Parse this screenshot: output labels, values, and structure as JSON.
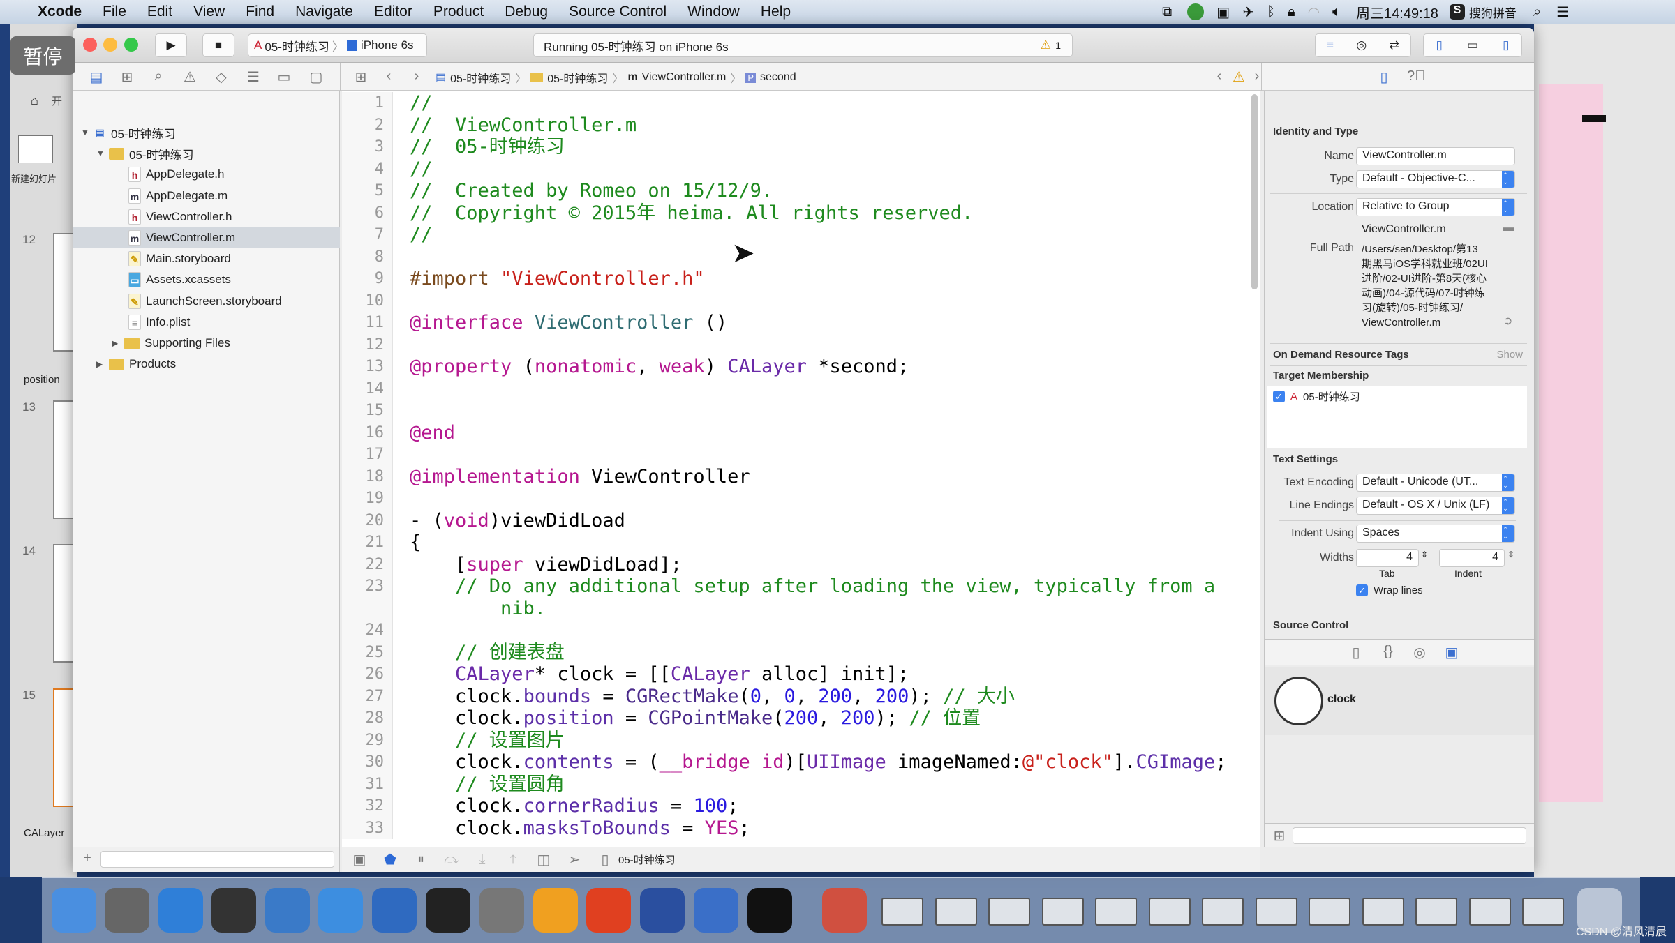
{
  "menubar": {
    "app": "Xcode",
    "items": [
      "File",
      "Edit",
      "View",
      "Find",
      "Navigate",
      "Editor",
      "Product",
      "Debug",
      "Source Control",
      "Window",
      "Help"
    ],
    "clock": "周三14:49:18",
    "input_method": "搜狗拼音"
  },
  "overlay": {
    "pause": "暂停"
  },
  "background_app": {
    "toolbar_label": "开",
    "new_slide": "新建幻灯片",
    "slide_numbers": [
      "12",
      "13",
      "14",
      "15"
    ],
    "section_position": "position",
    "section_calayer": "CALayer"
  },
  "toolbar": {
    "scheme": "05-时钟练习",
    "device": "iPhone 6s",
    "activity": "Running 05-时钟练习 on iPhone 6s",
    "warning_count": "1"
  },
  "jumpbar": {
    "crumbs": [
      "05-时钟练习",
      "05-时钟练习",
      "ViewController.m",
      "second"
    ]
  },
  "navigator": {
    "items": [
      {
        "label": "05-时钟练习",
        "kind": "project",
        "depth": 0,
        "expanded": true
      },
      {
        "label": "05-时钟练习",
        "kind": "folder",
        "depth": 1,
        "expanded": true
      },
      {
        "label": "AppDelegate.h",
        "kind": "h",
        "depth": 2
      },
      {
        "label": "AppDelegate.m",
        "kind": "m",
        "depth": 2
      },
      {
        "label": "ViewController.h",
        "kind": "h",
        "depth": 2
      },
      {
        "label": "ViewController.m",
        "kind": "m",
        "depth": 2,
        "selected": true
      },
      {
        "label": "Main.storyboard",
        "kind": "storyboard",
        "depth": 2
      },
      {
        "label": "Assets.xcassets",
        "kind": "assets",
        "depth": 2
      },
      {
        "label": "LaunchScreen.storyboard",
        "kind": "storyboard",
        "depth": 2
      },
      {
        "label": "Info.plist",
        "kind": "plist",
        "depth": 2
      },
      {
        "label": "Supporting Files",
        "kind": "folder",
        "depth": 2,
        "expanded": false
      },
      {
        "label": "Products",
        "kind": "folder",
        "depth": 1,
        "expanded": false
      }
    ]
  },
  "editor": {
    "lines": [
      {
        "n": "1",
        "t": [
          [
            "//",
            "c"
          ]
        ]
      },
      {
        "n": "2",
        "t": [
          [
            "//  ViewController.m",
            "c"
          ]
        ]
      },
      {
        "n": "3",
        "t": [
          [
            "//  05-时钟练习",
            "c"
          ]
        ]
      },
      {
        "n": "4",
        "t": [
          [
            "//",
            "c"
          ]
        ]
      },
      {
        "n": "5",
        "t": [
          [
            "//  Created by Romeo on 15/12/9.",
            "c"
          ]
        ]
      },
      {
        "n": "6",
        "t": [
          [
            "//  Copyright © 2015年 heima. All rights reserved.",
            "c"
          ]
        ]
      },
      {
        "n": "7",
        "t": [
          [
            "//",
            "c"
          ]
        ]
      },
      {
        "n": "8",
        "t": []
      },
      {
        "n": "9",
        "t": [
          [
            "#import ",
            "pp"
          ],
          [
            "\"ViewController.h\"",
            "str"
          ]
        ]
      },
      {
        "n": "10",
        "t": []
      },
      {
        "n": "11",
        "t": [
          [
            "@interface",
            "kw"
          ],
          [
            " ",
            ""
          ],
          [
            "ViewController",
            "proj"
          ],
          [
            " ()",
            ""
          ]
        ]
      },
      {
        "n": "12",
        "t": []
      },
      {
        "n": "13",
        "t": [
          [
            "@property",
            "kw"
          ],
          [
            " (",
            ""
          ],
          [
            "nonatomic",
            "kw"
          ],
          [
            ", ",
            ""
          ],
          [
            "weak",
            "kw"
          ],
          [
            ") ",
            ""
          ],
          [
            "CALayer",
            "cls"
          ],
          [
            " *second;",
            ""
          ]
        ]
      },
      {
        "n": "14",
        "t": []
      },
      {
        "n": "15",
        "t": []
      },
      {
        "n": "16",
        "t": [
          [
            "@end",
            "kw"
          ]
        ]
      },
      {
        "n": "17",
        "t": []
      },
      {
        "n": "18",
        "t": [
          [
            "@implementation",
            "kw"
          ],
          [
            " ViewController",
            ""
          ]
        ]
      },
      {
        "n": "19",
        "t": []
      },
      {
        "n": "20",
        "t": [
          [
            "- (",
            ""
          ],
          [
            "void",
            "kw"
          ],
          [
            ")viewDidLoad",
            ""
          ]
        ]
      },
      {
        "n": "21",
        "t": [
          [
            "{",
            ""
          ]
        ]
      },
      {
        "n": "22",
        "t": [
          [
            "    [",
            ""
          ],
          [
            "super",
            "kw"
          ],
          [
            " viewDidLoad];",
            ""
          ]
        ]
      },
      {
        "n": "23",
        "t": [
          [
            "    // Do any additional setup after loading the view, typically from a nib.",
            "c"
          ]
        ]
      },
      {
        "n": "24",
        "t": []
      },
      {
        "n": "25",
        "t": [
          [
            "    // 创建表盘",
            "c"
          ]
        ]
      },
      {
        "n": "26",
        "t": [
          [
            "    ",
            ""
          ],
          [
            "CALayer",
            "cls"
          ],
          [
            "* clock = [[",
            ""
          ],
          [
            "CALayer",
            "cls"
          ],
          [
            " alloc] init];",
            ""
          ]
        ]
      },
      {
        "n": "27",
        "t": [
          [
            "    clock.",
            ""
          ],
          [
            "bounds",
            "prop"
          ],
          [
            " = ",
            ""
          ],
          [
            "CGRectMake",
            "fn"
          ],
          [
            "(",
            ""
          ],
          [
            "0",
            "num"
          ],
          [
            ", ",
            ""
          ],
          [
            "0",
            "num"
          ],
          [
            ", ",
            ""
          ],
          [
            "200",
            "num"
          ],
          [
            ", ",
            ""
          ],
          [
            "200",
            "num"
          ],
          [
            "); ",
            ""
          ],
          [
            "// 大小",
            "c"
          ]
        ]
      },
      {
        "n": "28",
        "t": [
          [
            "    clock.",
            ""
          ],
          [
            "position",
            "prop"
          ],
          [
            " = ",
            ""
          ],
          [
            "CGPointMake",
            "fn"
          ],
          [
            "(",
            ""
          ],
          [
            "200",
            "num"
          ],
          [
            ", ",
            ""
          ],
          [
            "200",
            "num"
          ],
          [
            "); ",
            ""
          ],
          [
            "// 位置",
            "c"
          ]
        ]
      },
      {
        "n": "29",
        "t": [
          [
            "    // 设置图片",
            "c"
          ]
        ]
      },
      {
        "n": "30",
        "t": [
          [
            "    clock.",
            ""
          ],
          [
            "contents",
            "prop"
          ],
          [
            " = (",
            ""
          ],
          [
            "__bridge",
            "kw"
          ],
          [
            " ",
            ""
          ],
          [
            "id",
            "kw"
          ],
          [
            ")[",
            ""
          ],
          [
            "UIImage",
            "cls"
          ],
          [
            " imageNamed:",
            ""
          ],
          [
            "@\"clock\"",
            "str"
          ],
          [
            "].",
            ""
          ],
          [
            "CGImage",
            "prop"
          ],
          [
            ";",
            ""
          ]
        ]
      },
      {
        "n": "31",
        "t": [
          [
            "    // 设置圆角",
            "c"
          ]
        ]
      },
      {
        "n": "32",
        "t": [
          [
            "    clock.",
            ""
          ],
          [
            "cornerRadius",
            "prop"
          ],
          [
            " = ",
            ""
          ],
          [
            "100",
            "num"
          ],
          [
            ";",
            ""
          ]
        ]
      },
      {
        "n": "33",
        "t": [
          [
            "    clock.",
            ""
          ],
          [
            "masksToBounds",
            "prop"
          ],
          [
            " = ",
            ""
          ],
          [
            "YES",
            "kw"
          ],
          [
            ";",
            ""
          ]
        ]
      }
    ]
  },
  "inspector": {
    "identity_title": "Identity and Type",
    "name_label": "Name",
    "name_value": "ViewController.m",
    "type_label": "Type",
    "type_value": "Default - Objective-C...",
    "location_label": "Location",
    "location_value": "Relative to Group",
    "relative_name": "ViewController.m",
    "full_path_label": "Full Path",
    "full_path_lines": [
      "/Users/sen/Desktop/第13",
      "期黑马iOS学科就业班/02UI",
      "进阶/02-UI进阶-第8天(核心",
      "动画)/04-源代码/07-时钟练",
      "习(旋转)/05-时钟练习/",
      "ViewController.m"
    ],
    "odr_title": "On Demand Resource Tags",
    "odr_show": "Show",
    "target_title": "Target Membership",
    "target_name": "05-时钟练习",
    "target_checked": true,
    "text_settings_title": "Text Settings",
    "encoding_label": "Text Encoding",
    "encoding_value": "Default - Unicode (UT...",
    "line_endings_label": "Line Endings",
    "line_endings_value": "Default - OS X / Unix (LF)",
    "indent_label": "Indent Using",
    "indent_value": "Spaces",
    "widths_label": "Widths",
    "tab_width": "4",
    "indent_width": "4",
    "tab_label": "Tab",
    "indent_sub_label": "Indent",
    "wrap_label": "Wrap lines",
    "wrap_checked": true,
    "source_control_title": "Source Control",
    "library_item": "clock"
  },
  "debugbar": {
    "target": "05-时钟练习"
  },
  "dock": {
    "icons": [
      "finder-icon",
      "launchpad-icon",
      "safari-icon",
      "mouse-icon",
      "keynote-icon",
      "xcode-icon",
      "xcode-beta-icon",
      "terminal-icon",
      "system-preferences-icon",
      "sketch-icon",
      "paw-icon",
      "quicktime-icon",
      "screen-sharing-icon",
      "console-icon",
      "preview-icon"
    ],
    "window_count": 13,
    "watermark": "CSDN @清风清晨"
  }
}
